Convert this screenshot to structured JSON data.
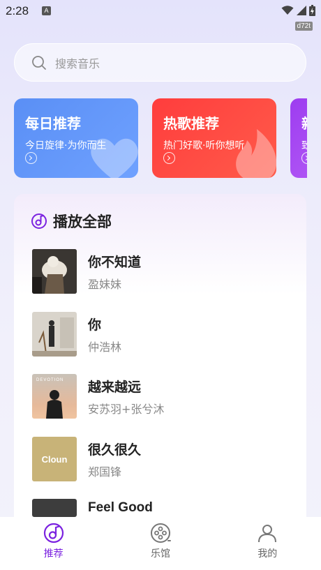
{
  "status_bar": {
    "time": "2:28",
    "notification_badge": "A",
    "version_tag": "d72t"
  },
  "search": {
    "placeholder": "搜索音乐"
  },
  "cards": [
    {
      "title": "每日推荐",
      "subtitle": "今日旋律·为你而生",
      "color": "#5a8ff5"
    },
    {
      "title": "热歌推荐",
      "subtitle": "热门好歌·听你想听",
      "color": "#ff3d3d"
    },
    {
      "title": "新",
      "subtitle": "致",
      "color": "#9d3cf0"
    }
  ],
  "panel": {
    "title": "播放全部"
  },
  "songs": [
    {
      "title": "你不知道",
      "artist": "盈妹妹"
    },
    {
      "title": "你",
      "artist": "仲浩林"
    },
    {
      "title": "越来越远",
      "artist": "安苏羽+张兮沐",
      "cover_text": "DEVOTION"
    },
    {
      "title": "很久很久",
      "artist": "郑国锋",
      "cover_text": "Cloun"
    },
    {
      "title": "Feel Good",
      "artist": ""
    }
  ],
  "bottom_nav": [
    {
      "label": "推荐",
      "icon": "music-disc-icon",
      "active": true
    },
    {
      "label": "乐馆",
      "icon": "film-reel-icon",
      "active": false
    },
    {
      "label": "我的",
      "icon": "user-icon",
      "active": false
    }
  ],
  "accent_color": "#7b22e0"
}
